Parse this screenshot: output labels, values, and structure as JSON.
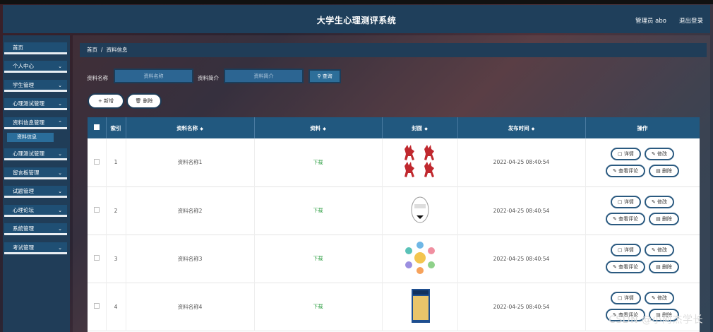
{
  "header": {
    "title": "大学生心理测评系统",
    "user": "管理员 abo",
    "logout": "退出登录"
  },
  "sidebar": {
    "items": [
      {
        "label": "首页",
        "chevron": false
      },
      {
        "label": "个人中心",
        "chevron": true
      },
      {
        "label": "学生管理",
        "chevron": true
      },
      {
        "label": "心理测试管理",
        "chevron": true
      },
      {
        "label": "资料信息管理",
        "chevron": true
      },
      {
        "label": "心理测试管理",
        "chevron": true
      },
      {
        "label": "留言板管理",
        "chevron": true
      },
      {
        "label": "试题管理",
        "chevron": true
      },
      {
        "label": "心理论坛",
        "chevron": true
      },
      {
        "label": "系统管理",
        "chevron": true
      },
      {
        "label": "考试管理",
        "chevron": true
      }
    ],
    "sub_item": "资料信息"
  },
  "breadcrumb": {
    "home": "首页",
    "sep": "/",
    "current": "资料信息"
  },
  "search": {
    "name_label": "资料名称",
    "name_placeholder": "资料名称",
    "intro_label": "资料简介",
    "intro_placeholder": "资料简介",
    "button": "查询"
  },
  "actions": {
    "add": "新增",
    "delete": "删除"
  },
  "table": {
    "headers": [
      "索引",
      "资料名称",
      "资料",
      "封面",
      "发布时间",
      "操作"
    ],
    "rows": [
      {
        "index": "1",
        "name": "资料名称1",
        "file": "下载",
        "time": "2022-04-25 08:40:54"
      },
      {
        "index": "2",
        "name": "资料名称2",
        "file": "下载",
        "time": "2022-04-25 08:40:54"
      },
      {
        "index": "3",
        "name": "资料名称3",
        "file": "下载",
        "time": "2022-04-25 08:40:54"
      },
      {
        "index": "4",
        "name": "资料名称4",
        "file": "下载",
        "time": "2022-04-25 08:40:54"
      }
    ],
    "op_labels": {
      "detail": "详情",
      "edit": "修改",
      "comments": "查看评论",
      "delete": "删除"
    }
  },
  "watermark": "CSDN @小阿杰学长",
  "colors": {
    "header_bg": "#1f3f5b",
    "table_head": "#21587f",
    "menu_bg": "#1f4f74",
    "accent_green": "#2a9d3f"
  }
}
